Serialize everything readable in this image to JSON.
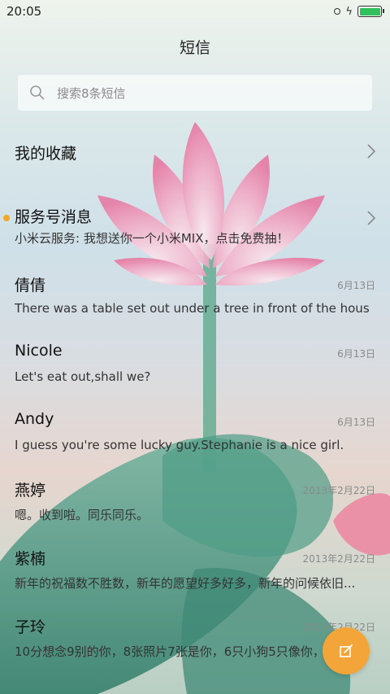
{
  "status_bar": {
    "time": "20:05"
  },
  "header": {
    "title": "短信"
  },
  "search": {
    "placeholder": "搜索8条短信"
  },
  "conversations": [
    {
      "name": "我的收藏",
      "preview": "",
      "date": ""
    },
    {
      "name": "服务号消息",
      "preview": "小米云服务: 我想送你一个小米MIX，点击免费抽！",
      "date": "",
      "unread": true
    },
    {
      "name": "倩倩",
      "preview": "There was a table set out under a tree in front of the hous",
      "date": "6月13日"
    },
    {
      "name": "Nicole",
      "preview": "Let's eat out,shall we?",
      "date": "6月13日"
    },
    {
      "name": "Andy",
      "preview": "I guess you're some lucky guy.Stephanie is a nice girl.",
      "date": "6月13日"
    },
    {
      "name": "燕婷",
      "preview": "嗯。收到啦。同乐同乐。",
      "date": "2013年2月22日"
    },
    {
      "name": "紫楠",
      "preview": "新年的祝福数不胜数，新年的愿望好多好多，新年的问候依旧...",
      "date": "2013年2月22日"
    },
    {
      "name": "子玲",
      "preview": "10分想念9别的你，8张照片7张是你，6只小狗5只像你，",
      "date": "2013年2月22日"
    }
  ],
  "icons": {
    "search": "search-icon",
    "chevron": "chevron-right-icon",
    "compose": "compose-icon",
    "battery": "battery-icon",
    "charging": "charging-icon"
  },
  "colors": {
    "accent": "#f4a53a",
    "unread_dot": "#f5a623",
    "battery": "#31c15c"
  }
}
